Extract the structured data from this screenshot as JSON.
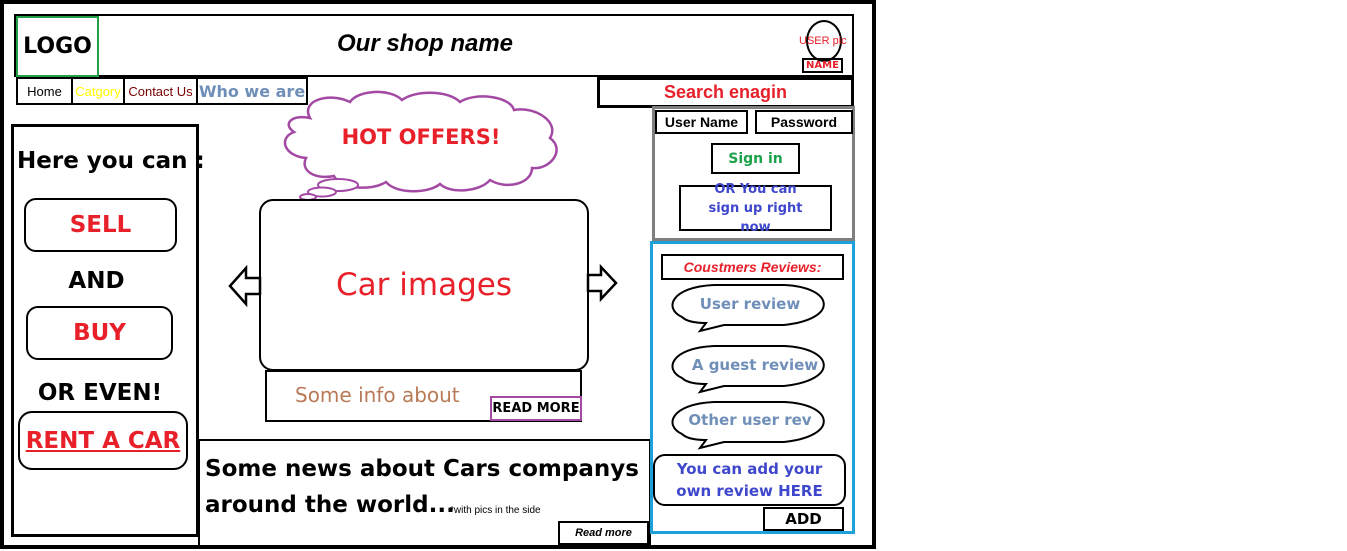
{
  "header": {
    "logo": "LOGO",
    "shop_name": "Our shop name",
    "user_pic": "USER pic",
    "user_name": "NAME"
  },
  "nav": {
    "items": [
      {
        "label": "Home",
        "color": "#000000"
      },
      {
        "label": "Catgory",
        "color": "#ffff00"
      },
      {
        "label": "Contact Us",
        "color": "#7a0000"
      },
      {
        "label": "Who we are",
        "color": "#6f8fb8"
      }
    ]
  },
  "search": {
    "placeholder": "Search enagin"
  },
  "login": {
    "username_label": "User Name",
    "password_label": "Password",
    "signin_label": "Sign in",
    "signup_label": "OR You can sign up right now"
  },
  "left_panel": {
    "heading": "Here you can :",
    "sell": "SELL",
    "and": "AND",
    "buy": "BUY",
    "or_even": "OR EVEN!",
    "rent": "RENT A CAR"
  },
  "offers": {
    "bubble": "HOT OFFERS!",
    "car_images": "Car images",
    "info": "Some info about",
    "read_more": "READ MORE"
  },
  "news": {
    "headline_line1": "Some news about Cars companys",
    "headline_line2": "around the world...",
    "note": "*with pics in the side",
    "read_more": "Read more"
  },
  "reviews": {
    "title": "Coustmers Reviews:",
    "items": [
      "User review",
      "A guest review",
      "Other user rev"
    ],
    "add_prompt": "You can add your own review HERE",
    "add_button": "ADD"
  },
  "colors": {
    "red": "#e8202a",
    "green": "#1ca24a",
    "blue_link": "#3f48cc",
    "review_text": "#6f8fb8",
    "reviews_border": "#1da1d8",
    "login_border": "#7f7f7f",
    "purple": "#a349a4",
    "info_text": "#b97a57"
  }
}
